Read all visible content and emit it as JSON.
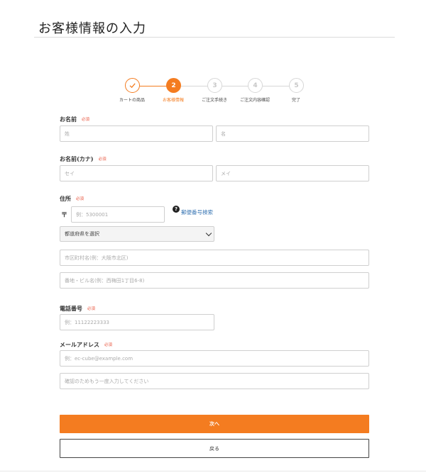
{
  "page": {
    "title": "お客様情報の入力"
  },
  "stepper": {
    "active_color": "#f47c20",
    "inactive_color": "#d7d7d7",
    "steps": [
      {
        "number": "1",
        "label": "カートの商品",
        "state": "done"
      },
      {
        "number": "2",
        "label": "お客様情報",
        "state": "current"
      },
      {
        "number": "3",
        "label": "ご注文手続き",
        "state": "todo"
      },
      {
        "number": "4",
        "label": "ご注文内容確認",
        "state": "todo"
      },
      {
        "number": "5",
        "label": "完了",
        "state": "todo"
      }
    ]
  },
  "form": {
    "required_badge": "必須",
    "name": {
      "label": "お名前",
      "last_placeholder": "姓",
      "first_placeholder": "名"
    },
    "kana": {
      "label": "お名前(カナ)",
      "last_placeholder": "セイ",
      "first_placeholder": "メイ"
    },
    "address": {
      "label": "住所",
      "postal_mark": "〒",
      "postal_placeholder": "例：5300001",
      "help_icon": "?",
      "zip_search_link": "郵便番号検索",
      "prefecture_selected": "都道府県を選択",
      "city_placeholder": "市区町村名(例：大阪市北区)",
      "street_placeholder": "番地・ビル名(例：西梅田1丁目6-8)"
    },
    "phone": {
      "label": "電話番号",
      "placeholder": "例：11122223333"
    },
    "email": {
      "label": "メールアドレス",
      "placeholder": "例：ec-cube@example.com",
      "confirm_placeholder": "確認のためもう一度入力してください"
    }
  },
  "buttons": {
    "next_label": "次へ",
    "back_label": "戻る",
    "next_color": "#f47c20"
  }
}
